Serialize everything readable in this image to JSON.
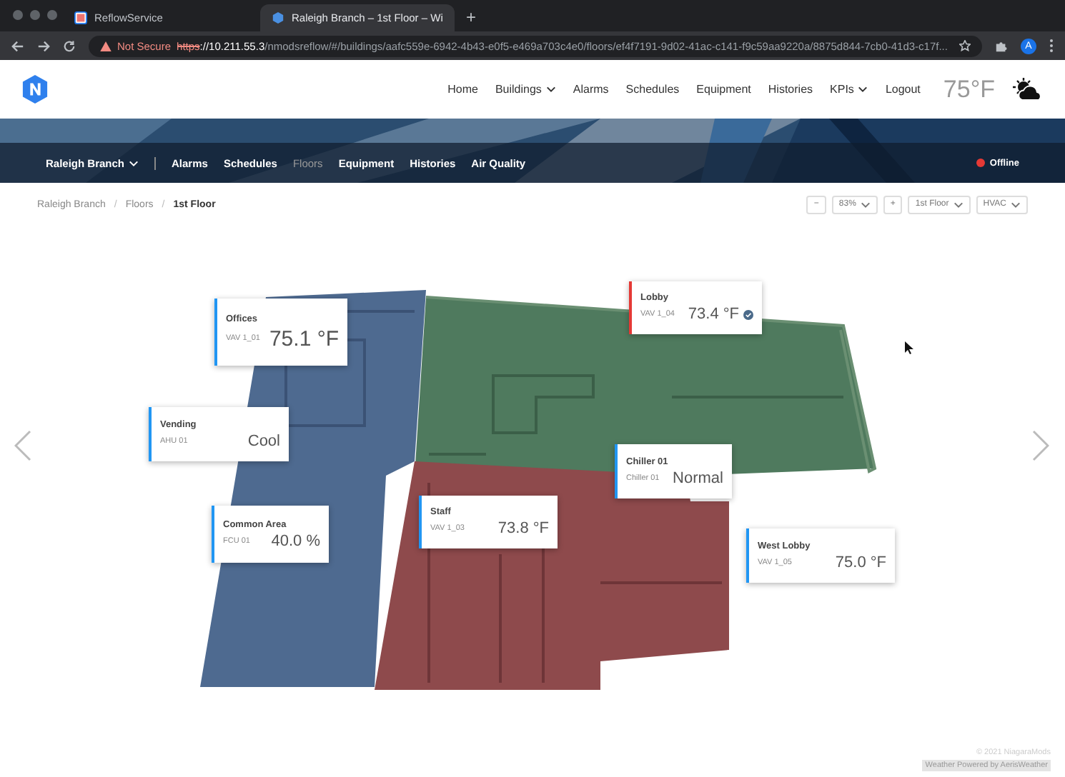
{
  "browser": {
    "tabs": [
      {
        "title": "ReflowService",
        "selected": false
      },
      {
        "title": "Raleigh Branch – 1st Floor – Wi",
        "selected": true
      }
    ],
    "new_tab": "+",
    "security": "Not Secure",
    "url_scheme": "https",
    "url_host": "://10.211.55.3",
    "url_path": "/nmodsreflow/#/buildings/aafc559e-6942-4b43-e0f5-e469a703c4e0/floors/ef4f7191-9d02-41ac-c141-f9c59aa9220a/8875d844-7cb0-41d3-c17f...",
    "avatar": "A"
  },
  "nav": {
    "items": [
      {
        "label": "Home",
        "dropdown": false
      },
      {
        "label": "Buildings",
        "dropdown": true
      },
      {
        "label": "Alarms",
        "dropdown": false
      },
      {
        "label": "Schedules",
        "dropdown": false
      },
      {
        "label": "Equipment",
        "dropdown": false
      },
      {
        "label": "Histories",
        "dropdown": false
      },
      {
        "label": "KPIs",
        "dropdown": true
      },
      {
        "label": "Logout",
        "dropdown": false
      }
    ],
    "temperature": "75°F"
  },
  "subnav": {
    "building": "Raleigh Branch",
    "items": [
      {
        "label": "Alarms",
        "selected": false
      },
      {
        "label": "Schedules",
        "selected": false
      },
      {
        "label": "Floors",
        "selected": true
      },
      {
        "label": "Equipment",
        "selected": false
      },
      {
        "label": "Histories",
        "selected": false
      },
      {
        "label": "Air Quality",
        "selected": false
      }
    ],
    "status": "Offline"
  },
  "breadcrumb": {
    "items": [
      "Raleigh Branch",
      "Floors",
      "1st Floor"
    ],
    "separator": "/"
  },
  "controls": {
    "zoom_out": "−",
    "zoom": "83%",
    "zoom_in": "+",
    "floor": "1st Floor",
    "system": "HVAC"
  },
  "zones": [
    {
      "name": "Offices",
      "device": "VAV 1_01",
      "value": "75.1 °F",
      "color": "#2196f3",
      "ok": false
    },
    {
      "name": "Vending",
      "device": "AHU 01",
      "value": "Cool",
      "color": "#2196f3",
      "ok": false
    },
    {
      "name": "Common Area",
      "device": "FCU 01",
      "value": "40.0 %",
      "color": "#2196f3",
      "ok": false
    },
    {
      "name": "Staff",
      "device": "VAV 1_03",
      "value": "73.8 °F",
      "color": "#2196f3",
      "ok": false
    },
    {
      "name": "Lobby",
      "device": "VAV 1_04",
      "value": "73.4 °F",
      "color": "#e53935",
      "ok": true
    },
    {
      "name": "Chiller 01",
      "device": "Chiller 01",
      "value": "Normal",
      "color": "#2196f3",
      "ok": false
    },
    {
      "name": "West Lobby",
      "device": "VAV 1_05",
      "value": "75.0 °F",
      "color": "#2196f3",
      "ok": false
    }
  ],
  "footer": {
    "copyright": "© 2021 NiagaraMods",
    "weather_credit": "Weather Powered by AerisWeather"
  }
}
